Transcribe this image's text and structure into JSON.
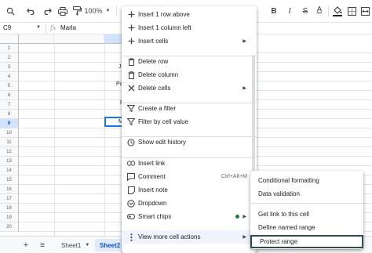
{
  "toolbar": {
    "zoom": "100%",
    "colors": {
      "text_color_bar": "#202124"
    }
  },
  "formula_bar": {
    "cell_ref": "C9",
    "fx_label": "fx",
    "value": "Marla"
  },
  "grid": {
    "rows": [
      "1",
      "2",
      "3",
      "4",
      "5",
      "6",
      "7",
      "8",
      "9",
      "10",
      "11",
      "12",
      "13",
      "14",
      "15",
      "16",
      "17",
      "18",
      "19",
      "20"
    ],
    "selected_row": "9",
    "partial_cells": [
      {
        "text": "J",
        "row": "4"
      },
      {
        "text": "Pa",
        "row": "5"
      },
      {
        "text": "R",
        "row": "7"
      },
      {
        "text": "M",
        "row": "9"
      }
    ]
  },
  "tabs": {
    "add_label": "+",
    "menu_label": "≡",
    "sheets": [
      "Sheet1",
      "Sheet2"
    ],
    "active_sheet": "Sheet2"
  },
  "context_menu": {
    "items": [
      {
        "label": "Insert 1 row above",
        "icon": "plus-icon"
      },
      {
        "label": "Insert 1 column left",
        "icon": "plus-icon"
      },
      {
        "label": "Insert cells",
        "icon": "plus-icon",
        "submenu": true
      },
      {
        "label": "Delete row",
        "icon": "trash-icon"
      },
      {
        "label": "Delete column",
        "icon": "trash-icon"
      },
      {
        "label": "Delete cells",
        "icon": "close-icon",
        "submenu": true
      },
      {
        "label": "Create a filter",
        "icon": "filter-icon"
      },
      {
        "label": "Filter by cell value",
        "icon": "filter-icon"
      },
      {
        "label": "Show edit history",
        "icon": "history-icon"
      },
      {
        "label": "Insert link",
        "icon": "link-icon"
      },
      {
        "label": "Comment",
        "icon": "comment-icon",
        "shortcut": "Ctrl+Alt+M"
      },
      {
        "label": "Insert note",
        "icon": "note-icon"
      },
      {
        "label": "Dropdown",
        "icon": "dropdown-icon"
      },
      {
        "label": "Smart chips",
        "icon": "smart-chip-icon",
        "submenu": true,
        "status_dot": "#188038"
      },
      {
        "label": "View more cell actions",
        "icon": "more-vert-icon",
        "submenu": true,
        "highlighted": true
      }
    ]
  },
  "submenu": {
    "items": [
      {
        "label": "Conditional formatting"
      },
      {
        "label": "Data validation"
      },
      {
        "label": "Get link to this cell"
      },
      {
        "label": "Define named range"
      },
      {
        "label": "Protect range",
        "focused": true
      }
    ]
  }
}
